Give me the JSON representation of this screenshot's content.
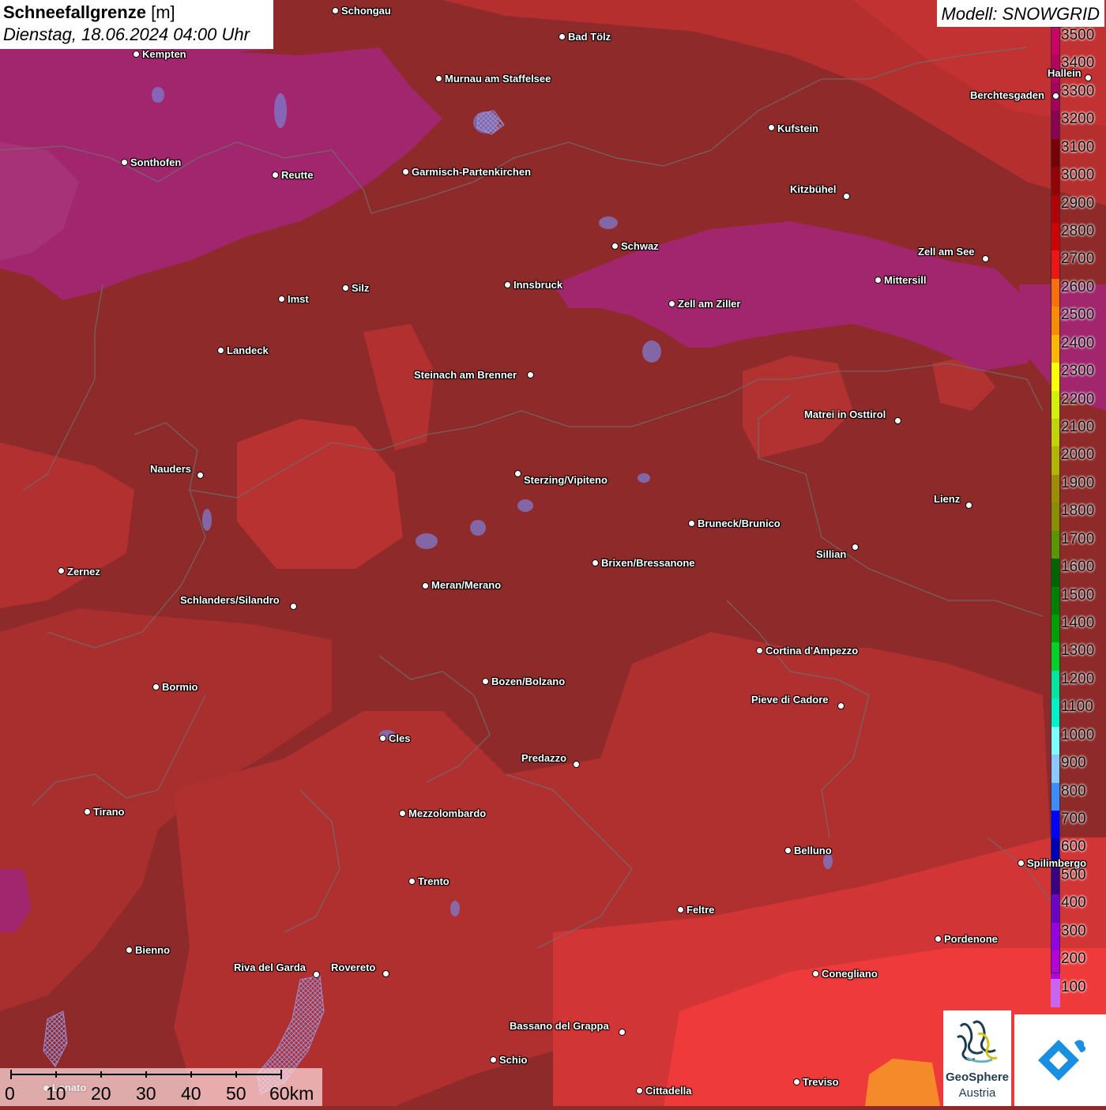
{
  "header": {
    "title_bold": "Schneefallgrenze",
    "title_unit": "[m]",
    "datetime": "Dienstag, 18.06.2024 04:00 Uhr",
    "model": "Modell: SNOWGRID"
  },
  "legend": {
    "entries": [
      {
        "label": "3500",
        "color": "#cc0066"
      },
      {
        "label": "3400",
        "color": "#b8005e"
      },
      {
        "label": "3300",
        "color": "#a6005a"
      },
      {
        "label": "3200",
        "color": "#8c0050"
      },
      {
        "label": "3100",
        "color": "#780000"
      },
      {
        "label": "3000",
        "color": "#960000"
      },
      {
        "label": "2900",
        "color": "#b40000"
      },
      {
        "label": "2800",
        "color": "#d20000"
      },
      {
        "label": "2700",
        "color": "#f01414"
      },
      {
        "label": "2600",
        "color": "#ff6e0a"
      },
      {
        "label": "2500",
        "color": "#ff8c00"
      },
      {
        "label": "2400",
        "color": "#ffb400"
      },
      {
        "label": "2300",
        "color": "#ffff00"
      },
      {
        "label": "2200",
        "color": "#d2f000"
      },
      {
        "label": "2100",
        "color": "#c3d200"
      },
      {
        "label": "2000",
        "color": "#b4b400"
      },
      {
        "label": "1900",
        "color": "#a08c00"
      },
      {
        "label": "1800",
        "color": "#8c8c00"
      },
      {
        "label": "1700",
        "color": "#5a9600"
      },
      {
        "label": "1600",
        "color": "#006400"
      },
      {
        "label": "1500",
        "color": "#008200"
      },
      {
        "label": "1400",
        "color": "#00a000"
      },
      {
        "label": "1300",
        "color": "#00d228"
      },
      {
        "label": "1200",
        "color": "#00e6a0"
      },
      {
        "label": "1100",
        "color": "#00f0c8"
      },
      {
        "label": "1000",
        "color": "#7dffff"
      },
      {
        "label": "900",
        "color": "#8cc8ff"
      },
      {
        "label": "800",
        "color": "#3c8cff"
      },
      {
        "label": "700",
        "color": "#0000ff"
      },
      {
        "label": "600",
        "color": "#0000b4"
      },
      {
        "label": "500",
        "color": "#3c0082"
      },
      {
        "label": "400",
        "color": "#6e00c8"
      },
      {
        "label": "300",
        "color": "#9600e6"
      },
      {
        "label": "200",
        "color": "#b400dc"
      },
      {
        "label": "100",
        "color": "#c864f0"
      }
    ]
  },
  "cities": [
    {
      "name": "Schongau"
    },
    {
      "name": "Bad Tölz"
    },
    {
      "name": "Kempten"
    },
    {
      "name": "Murnau am Staffelsee"
    },
    {
      "name": "Hallein"
    },
    {
      "name": "Berchtesgaden"
    },
    {
      "name": "Kufstein"
    },
    {
      "name": "Sonthofen"
    },
    {
      "name": "Reutte"
    },
    {
      "name": "Garmisch-Partenkirchen"
    },
    {
      "name": "Kitzbühel"
    },
    {
      "name": "Schwaz"
    },
    {
      "name": "Zell am See"
    },
    {
      "name": "Mittersill"
    },
    {
      "name": "Innsbruck"
    },
    {
      "name": "Imst"
    },
    {
      "name": "Silz"
    },
    {
      "name": "Zell am Ziller"
    },
    {
      "name": "Landeck"
    },
    {
      "name": "Steinach am Brenner"
    },
    {
      "name": "Matrei in Osttirol"
    },
    {
      "name": "Nauders"
    },
    {
      "name": "Sterzing/Vipiteno"
    },
    {
      "name": "Lienz"
    },
    {
      "name": "Bruneck/Brunico"
    },
    {
      "name": "Sillian"
    },
    {
      "name": "Zernez"
    },
    {
      "name": "Brixen/Bressanone"
    },
    {
      "name": "Meran/Merano"
    },
    {
      "name": "Schlanders/Silandro"
    },
    {
      "name": "Cortina d'Ampezzo"
    },
    {
      "name": "Bormio"
    },
    {
      "name": "Bozen/Bolzano"
    },
    {
      "name": "Pieve di Cadore"
    },
    {
      "name": "Cles"
    },
    {
      "name": "Predazzo"
    },
    {
      "name": "Tirano"
    },
    {
      "name": "Mezzolombardo"
    },
    {
      "name": "Belluno"
    },
    {
      "name": "Spilimbergo"
    },
    {
      "name": "Trento"
    },
    {
      "name": "Feltre"
    },
    {
      "name": "Pordenone"
    },
    {
      "name": "Bienno"
    },
    {
      "name": "Riva del Garda"
    },
    {
      "name": "Rovereto"
    },
    {
      "name": "Conegliano"
    },
    {
      "name": "Bassano del Grappa"
    },
    {
      "name": "Schio"
    },
    {
      "name": "Treviso"
    },
    {
      "name": "Cittadella"
    },
    {
      "name": "Lonato"
    }
  ],
  "scale": {
    "labels": [
      "0",
      "10",
      "20",
      "30",
      "40",
      "50",
      "60km"
    ]
  },
  "logos": {
    "geosphere_line1": "GeoSphere",
    "geosphere_line2": "Austria"
  }
}
